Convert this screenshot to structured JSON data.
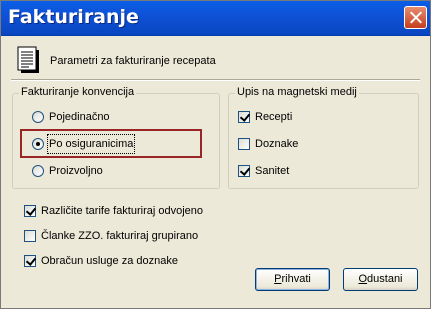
{
  "window": {
    "title": "Fakturiranje"
  },
  "header": {
    "icon": "document-list-icon",
    "text": "Parametri za fakturiranje recepata"
  },
  "convention_group": {
    "legend": "Fakturiranje konvencija",
    "options": [
      {
        "label": "Pojedinačno",
        "checked": false
      },
      {
        "label": "Po osiguranicima",
        "checked": true
      },
      {
        "label": "Proizvoljno",
        "checked": false
      }
    ]
  },
  "media_group": {
    "legend": "Upis na magnetski medij",
    "options": [
      {
        "label": "Recepti",
        "checked": true
      },
      {
        "label": "Doznake",
        "checked": false
      },
      {
        "label": "Sanitet",
        "checked": true
      }
    ]
  },
  "extra_options": [
    {
      "label": "Različite tarife fakturiraj odvojeno",
      "checked": true
    },
    {
      "label": "Članke ZZO. fakturiraj grupirano",
      "checked": false
    },
    {
      "label": "Obračun usluge za doznake",
      "checked": true
    }
  ],
  "buttons": {
    "accept_prefix": "",
    "accept_mnemonic": "P",
    "accept_rest": "rihvati",
    "cancel_prefix": "",
    "cancel_mnemonic": "O",
    "cancel_rest": "dustani"
  },
  "colors": {
    "titlebar": "#0f4fd4",
    "dialog_bg": "#ece9d8",
    "highlight_border": "#9b2424"
  }
}
